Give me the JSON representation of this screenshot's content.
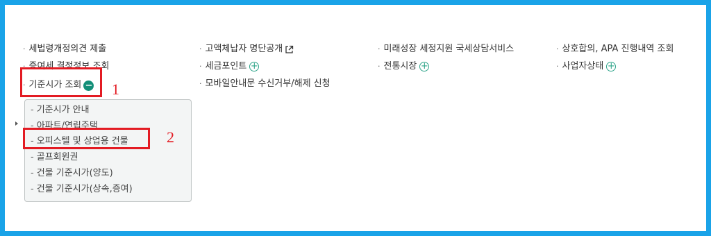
{
  "menu": {
    "col1": [
      "세법령개정의견 제출",
      "증여세 결정정보 조회",
      "기준시가 조회"
    ],
    "col2": [
      "고액체납자 명단공개",
      "세금포인트",
      "모바일안내문 수신거부/해제 신청"
    ],
    "col3": [
      "미래성장 세정지원 국세상담서비스",
      "전통시장"
    ],
    "col4": [
      "상호합의, APA 진행내역 조회",
      "사업자상태"
    ]
  },
  "dropdown": {
    "items": [
      "기준시가 안내",
      "아파트/연립주택",
      "오피스텔 및 상업용 건물",
      "골프회원권",
      "건물 기준시가(양도)",
      "건물 기준시가(상속,증여)"
    ]
  },
  "annotations": {
    "num1": "1",
    "num2": "2"
  },
  "colors": {
    "frame": "#1aa3e8",
    "accent": "#138f78",
    "highlight": "#e31b23"
  },
  "icons": {
    "expand": "plus-circle-icon",
    "collapse": "minus-circle-icon",
    "external": "external-link-icon"
  }
}
